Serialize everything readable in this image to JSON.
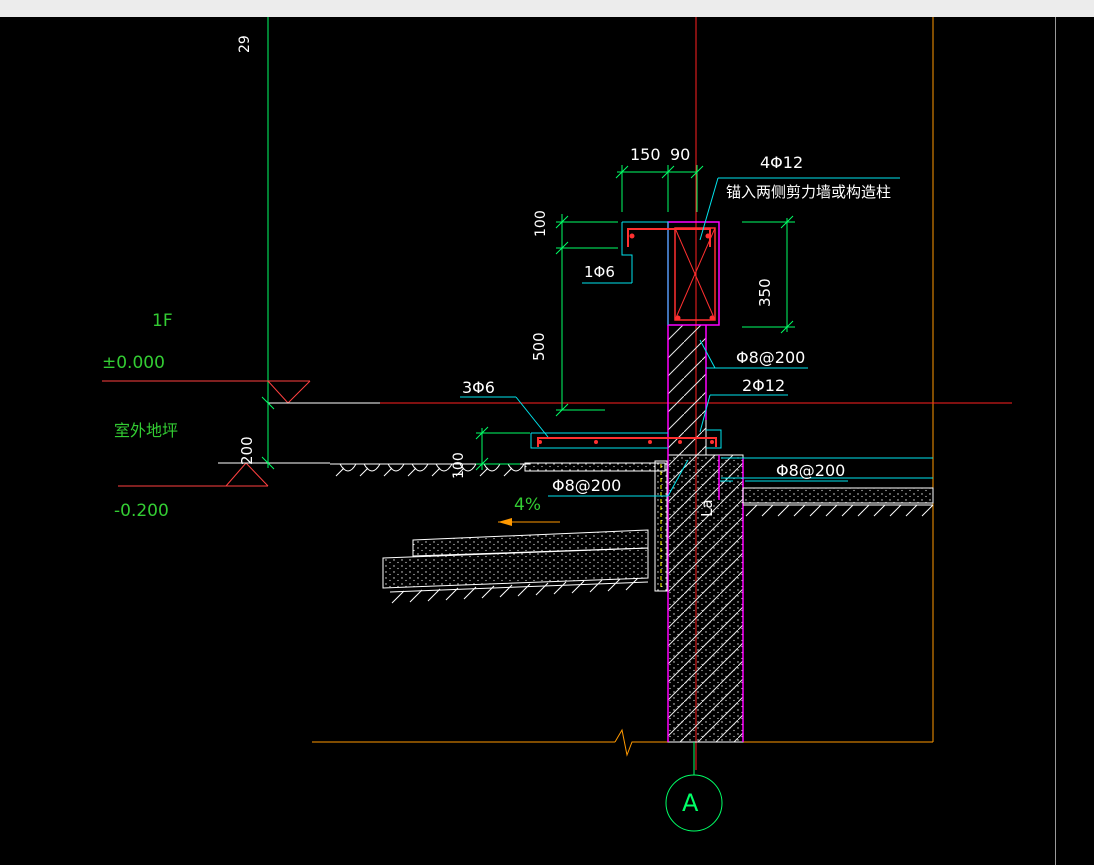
{
  "colors": {
    "background": "#000000",
    "dimension": "#00ff66",
    "text": "#ffffff",
    "green_text": "#33cc33",
    "axis": "#ff2020",
    "rebar": "#ff3030",
    "outline": "#00e5ee",
    "column": "#ff00ff",
    "border": "#ff9900",
    "hatch": "#e8e8e8"
  },
  "dims": {
    "w150": "150",
    "w90": "90",
    "h100_top": "100",
    "h350": "350",
    "h500": "500",
    "h200": "200",
    "h100_bottom": "100",
    "top_clipped": "29"
  },
  "labels": {
    "rebar_main": "4Φ12",
    "anchor_note": "锚入两侧剪力墙或构造柱",
    "stirrup_top": "1Φ6",
    "wall_stirrup": "Φ8@200",
    "wall_bars": "2Φ12",
    "slab_bars": "3Φ6",
    "slab_dist_left": "Φ8@200",
    "slab_dist_right": "Φ8@200",
    "anchor_len": "La",
    "slope": "4%"
  },
  "levels": {
    "floor": "1F",
    "zero": "±0.000",
    "outdoor": "室外地坪",
    "minus": "-0.200"
  },
  "axis_label": "A"
}
